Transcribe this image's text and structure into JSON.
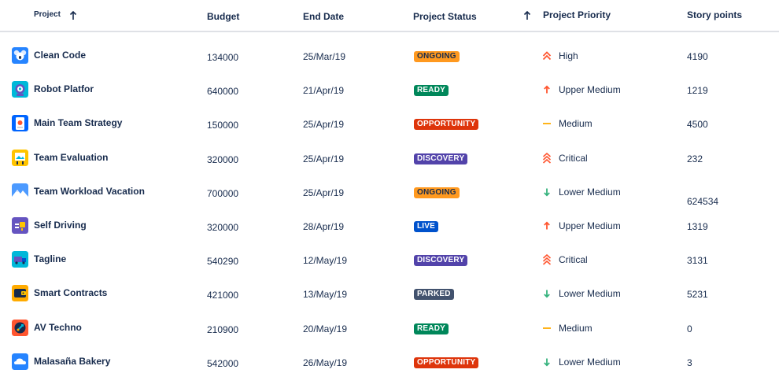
{
  "columns": {
    "project": "Project",
    "budget": "Budget",
    "end_date": "End Date",
    "status": "Project Status",
    "priority": "Project Priority",
    "story_points": "Story points"
  },
  "status_colors": {
    "ONGOING": {
      "bg": "#ff991f",
      "fg": "#172b4d"
    },
    "READY": {
      "bg": "#00875a",
      "fg": "#ffffff"
    },
    "OPPORTUNITY": {
      "bg": "#de350b",
      "fg": "#ffffff"
    },
    "DISCOVERY": {
      "bg": "#5243aa",
      "fg": "#ffffff"
    },
    "LIVE": {
      "bg": "#0052cc",
      "fg": "#ffffff"
    },
    "PARKED": {
      "bg": "#42526e",
      "fg": "#ffffff"
    }
  },
  "rows": [
    {
      "name": "Clean Code",
      "icon": "koala-icon",
      "budget": "134000",
      "end_date": "25/Mar/19",
      "status": "ONGOING",
      "priority": "High",
      "priority_icon": "double-chevron-up-icon",
      "story_points": "4190"
    },
    {
      "name": "Robot Platfor",
      "icon": "robot-icon",
      "budget": "640000",
      "end_date": "21/Apr/19",
      "status": "READY",
      "priority": "Upper Medium",
      "priority_icon": "arrow-up-icon",
      "story_points": "1219"
    },
    {
      "name": "Main Team Strategy",
      "icon": "phone-icon",
      "budget": "150000",
      "end_date": "25/Apr/19",
      "status": "OPPORTUNITY",
      "priority": "Medium",
      "priority_icon": "dash-icon",
      "story_points": "4500"
    },
    {
      "name": "Team Evaluation",
      "icon": "easel-icon",
      "budget": "320000",
      "end_date": "25/Apr/19",
      "status": "DISCOVERY",
      "priority": "Critical",
      "priority_icon": "triple-chevron-up-icon",
      "story_points": "232"
    },
    {
      "name": "Team Workload Vacation",
      "icon": "mountains-icon",
      "budget": "700000",
      "end_date": "25/Apr/19",
      "status": "ONGOING",
      "priority": "Lower Medium",
      "priority_icon": "arrow-down-icon",
      "story_points": "624534"
    },
    {
      "name": "Self Driving",
      "icon": "chip-icon",
      "budget": "320000",
      "end_date": "28/Apr/19",
      "status": "LIVE",
      "priority": "Upper Medium",
      "priority_icon": "arrow-up-icon",
      "story_points": "1319"
    },
    {
      "name": "Tagline",
      "icon": "truck-icon",
      "budget": "540290",
      "end_date": "12/May/19",
      "status": "DISCOVERY",
      "priority": "Critical",
      "priority_icon": "triple-chevron-up-icon",
      "story_points": "3131"
    },
    {
      "name": "Smart Contracts",
      "icon": "wallet-icon",
      "budget": "421000",
      "end_date": "13/May/19",
      "status": "PARKED",
      "priority": "Lower Medium",
      "priority_icon": "arrow-down-icon",
      "story_points": "5231"
    },
    {
      "name": "AV Techno",
      "icon": "rocket-icon",
      "budget": "210900",
      "end_date": "20/May/19",
      "status": "READY",
      "priority": "Medium",
      "priority_icon": "dash-icon",
      "story_points": "0"
    },
    {
      "name": "Malasaña Bakery",
      "icon": "cloud-icon",
      "budget": "542000",
      "end_date": "26/May/19",
      "status": "OPPORTUNITY",
      "priority": "Lower Medium",
      "priority_icon": "arrow-down-icon",
      "story_points": "3"
    }
  ]
}
